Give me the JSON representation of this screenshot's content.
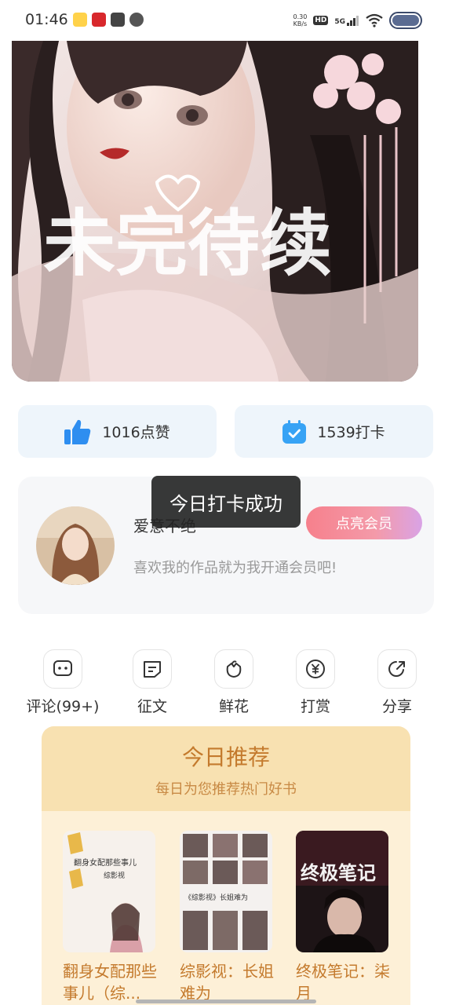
{
  "status_bar": {
    "time": "01:46",
    "net_speed_value": "0.30",
    "net_speed_unit": "KB/s",
    "hd_label": "HD",
    "network_label": "5G"
  },
  "cover": {
    "overlay_text": "未完待续"
  },
  "stats": {
    "likes_label": "1016点赞",
    "checkin_label": "1539打卡"
  },
  "author": {
    "name": "爱意不绝",
    "description": "喜欢我的作品就为我开通会员吧!",
    "vip_button_label": "点亮会员"
  },
  "toast": {
    "message": "今日打卡成功"
  },
  "actions": [
    {
      "label": "评论(99+)",
      "icon": "comment-icon"
    },
    {
      "label": "征文",
      "icon": "essay-icon"
    },
    {
      "label": "鲜花",
      "icon": "flower-icon"
    },
    {
      "label": "打赏",
      "icon": "yuan-coin-icon"
    },
    {
      "label": "分享",
      "icon": "share-icon"
    }
  ],
  "recommend": {
    "title": "今日推荐",
    "subtitle": "每日为您推荐热门好书",
    "books": [
      {
        "title": "翻身女配那些事儿（综...",
        "cover_text": "翻身女配那些事儿",
        "cover_subtext": "综影视"
      },
      {
        "title": "综影视：长姐难为",
        "cover_text": "《综影视》长姐难为"
      },
      {
        "title": "终极笔记：柒月",
        "cover_text": "终极笔记"
      }
    ]
  },
  "colors": {
    "accent_orange": "#c47a2d",
    "like_blue": "#2e8ef0",
    "vip_gradient_start": "#f6808c",
    "vip_gradient_end": "#d9a3e6"
  }
}
